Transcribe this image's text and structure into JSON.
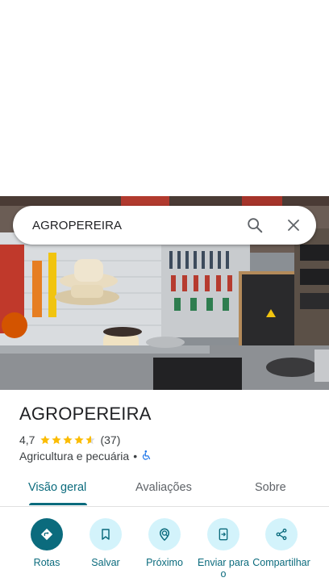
{
  "search": {
    "query": "AGROPEREIRA"
  },
  "place": {
    "name": "AGROPEREIRA",
    "rating": "4,7",
    "rating_value": 4.7,
    "review_count": "(37)",
    "category": "Agricultura e pecuária",
    "separator": "•",
    "accessibility": "wheelchair-icon"
  },
  "tabs": [
    {
      "label": "Visão geral",
      "active": true
    },
    {
      "label": "Avaliações",
      "active": false
    },
    {
      "label": "Sobre",
      "active": false
    }
  ],
  "actions": [
    {
      "label": "Rotas",
      "icon": "directions-icon",
      "primary": true
    },
    {
      "label": "Salvar",
      "icon": "bookmark-icon",
      "primary": false
    },
    {
      "label": "Próximo",
      "icon": "nearby-icon",
      "primary": false
    },
    {
      "label": "Enviar para o",
      "icon": "send-to-phone-icon",
      "primary": false
    },
    {
      "label": "Compartilhar",
      "icon": "share-icon",
      "primary": false
    }
  ],
  "colors": {
    "accent": "#0b6b7d",
    "action_bg": "#d3f3fb",
    "star": "#fbbc04"
  }
}
